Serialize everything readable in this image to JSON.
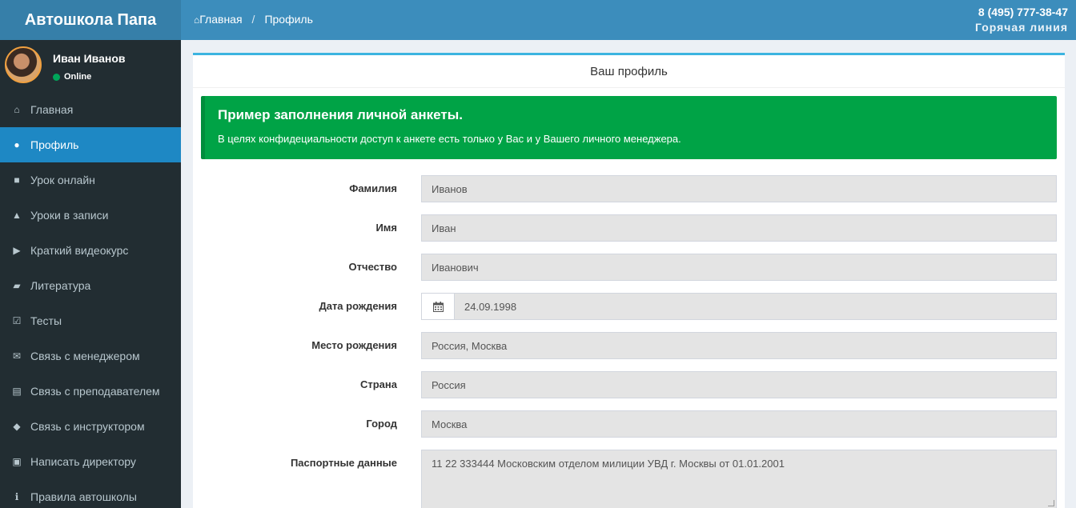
{
  "brand": "Автошкола Папа",
  "user": {
    "name": "Иван Иванов",
    "status": "Online"
  },
  "sidebar": {
    "items": [
      {
        "label": "Главная",
        "icon": "home-icon",
        "glyph": "⌂"
      },
      {
        "label": "Профиль",
        "icon": "user-icon",
        "glyph": "●",
        "active": true
      },
      {
        "label": "Урок онлайн",
        "icon": "video-icon",
        "glyph": "■"
      },
      {
        "label": "Уроки в записи",
        "icon": "graduation-cap-icon",
        "glyph": "▲"
      },
      {
        "label": "Краткий видеокурс",
        "icon": "play-square-icon",
        "glyph": "▶"
      },
      {
        "label": "Литература",
        "icon": "book-icon",
        "glyph": "▰"
      },
      {
        "label": "Тесты",
        "icon": "check-square-icon",
        "glyph": "☑"
      },
      {
        "label": "Связь с менеджером",
        "icon": "envelope-icon",
        "glyph": "✉"
      },
      {
        "label": "Связь с преподавателем",
        "icon": "id-card-icon",
        "glyph": "▤"
      },
      {
        "label": "Связь с инструктором",
        "icon": "car-icon",
        "glyph": "◆"
      },
      {
        "label": "Написать директору",
        "icon": "lock-icon",
        "glyph": "▣"
      },
      {
        "label": "Правила автошколы",
        "icon": "info-circle-icon",
        "glyph": "ℹ"
      }
    ]
  },
  "header": {
    "breadcrumb": {
      "home": "Главная",
      "current": "Профиль"
    },
    "phone": "8 (495) 777-38-47",
    "hotline": "Горячая линия"
  },
  "box": {
    "title": "Ваш профиль"
  },
  "alert": {
    "title": "Пример заполнения личной анкеты.",
    "text": "В целях конфидециальности доступ к анкете есть только у Вас и у Вашего личного менеджера."
  },
  "form": {
    "surname": {
      "label": "Фамилия",
      "value": "Иванов"
    },
    "name": {
      "label": "Имя",
      "value": "Иван"
    },
    "patronymic": {
      "label": "Отчество",
      "value": "Иванович"
    },
    "birthdate": {
      "label": "Дата рождения",
      "value": "24.09.1998"
    },
    "birthplace": {
      "label": "Место рождения",
      "value": "Россия, Москва"
    },
    "country": {
      "label": "Страна",
      "value": "Россия"
    },
    "city": {
      "label": "Город",
      "value": "Москва"
    },
    "passport": {
      "label": "Паспортные данные",
      "value": "11 22 333444 Московским отделом милиции УВД г. Москвы от 01.01.2001"
    }
  },
  "colors": {
    "header": "#3c8dbc",
    "logo": "#367fa9",
    "sidebar": "#222d32",
    "active": "#1e88c4",
    "alert": "#00a346"
  }
}
